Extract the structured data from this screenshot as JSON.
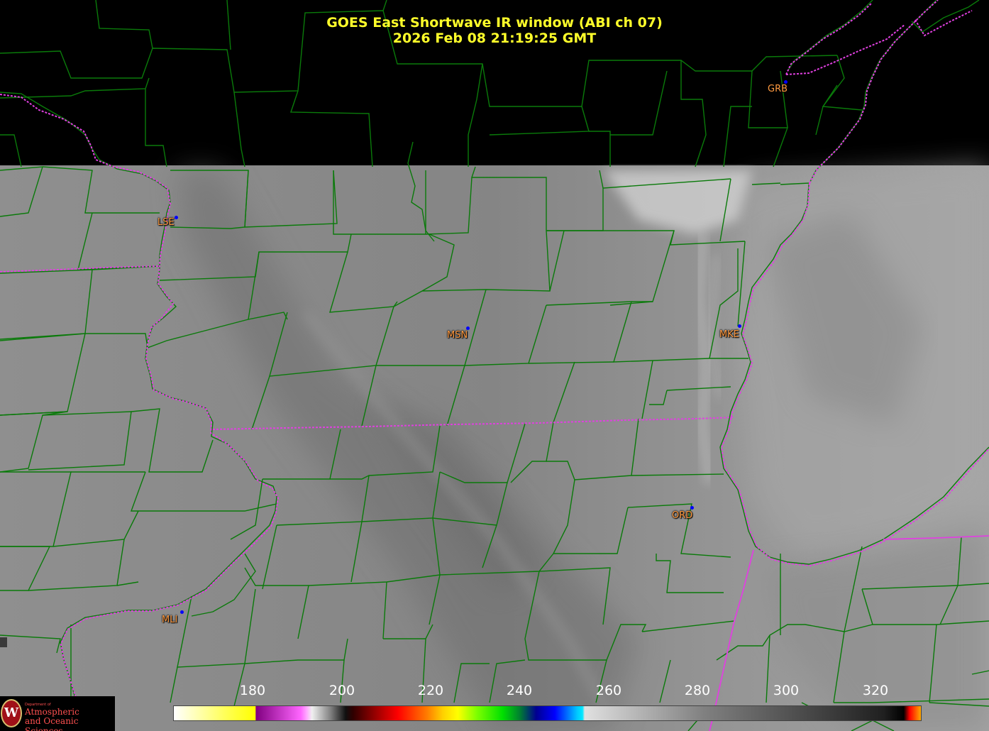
{
  "title_line1": "GOES East Shortwave IR window (ABI ch 07)",
  "title_line2": "2026 Feb 08  21:19:25 GMT",
  "stations": [
    {
      "id": "GRB",
      "label": "GRB"
    },
    {
      "id": "LSE",
      "label": "LSE"
    },
    {
      "id": "MSN",
      "label": "MSN"
    },
    {
      "id": "MKE",
      "label": "MKE"
    },
    {
      "id": "ORD",
      "label": "ORD"
    },
    {
      "id": "MLI",
      "label": "MLI"
    }
  ],
  "colorbar": {
    "ticks": [
      "180",
      "200",
      "220",
      "240",
      "260",
      "280",
      "300",
      "320"
    ]
  },
  "logo": {
    "seal": "W",
    "dept": "Department of",
    "line1": "Atmospheric",
    "line2": "and Oceanic Sciences"
  },
  "colors": {
    "county_lines": "#0a7a0a",
    "state_lines": "#e040e0",
    "title": "#ffff2a",
    "station_label": "#ff9a40",
    "station_dot": "#0000ff"
  }
}
